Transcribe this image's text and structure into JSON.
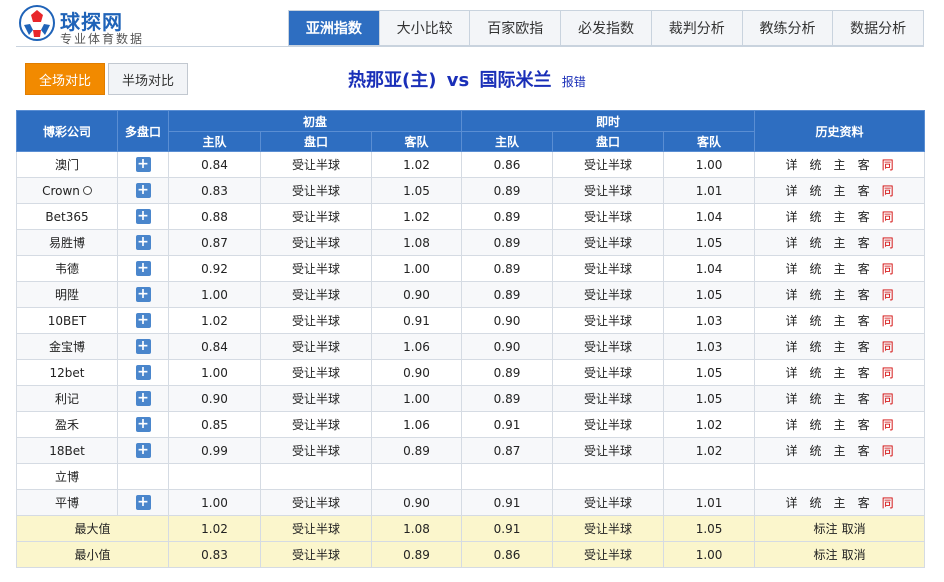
{
  "logo": {
    "title": "球探网",
    "subtitle": "专业体育数据"
  },
  "top_tabs": [
    "亚洲指数",
    "大小比较",
    "百家欧指",
    "必发指数",
    "裁判分析",
    "教练分析",
    "数据分析"
  ],
  "sub_tabs": {
    "full": "全场对比",
    "half": "半场对比"
  },
  "match": {
    "home": "热那亚(主)",
    "vs": "vs",
    "away": "国际米兰",
    "report": "报错"
  },
  "table": {
    "headers": {
      "company": "博彩公司",
      "multi": "多盘口",
      "initial": "初盘",
      "live": "即时",
      "history": "历史资料",
      "home": "主队",
      "handicap": "盘口",
      "away": "客队"
    },
    "history_links": [
      "详",
      "统",
      "主",
      "客",
      "同"
    ],
    "rows": [
      {
        "company": "澳门",
        "plus": true,
        "i_home": "0.84",
        "i_line": "受让半球",
        "i_away": "1.02",
        "l_home": "0.86",
        "l_line": "受让半球",
        "l_away": "1.00",
        "history": true
      },
      {
        "company": "Crown",
        "ball": true,
        "plus": true,
        "i_home": "0.83",
        "i_line": "受让半球",
        "i_away": "1.05",
        "l_home": "0.89",
        "l_line": "受让半球",
        "l_away": "1.01",
        "history": true
      },
      {
        "company": "Bet365",
        "plus": true,
        "i_home": "0.88",
        "i_line": "受让半球",
        "i_away": "1.02",
        "l_home": "0.89",
        "l_line": "受让半球",
        "l_away": "1.04",
        "history": true
      },
      {
        "company": "易胜博",
        "plus": true,
        "i_home": "0.87",
        "i_line": "受让半球",
        "i_away": "1.08",
        "l_home": "0.89",
        "l_line": "受让半球",
        "l_away": "1.05",
        "history": true
      },
      {
        "company": "韦德",
        "plus": true,
        "i_home": "0.92",
        "i_line": "受让半球",
        "i_away": "1.00",
        "l_home": "0.89",
        "l_line": "受让半球",
        "l_away": "1.04",
        "history": true
      },
      {
        "company": "明陞",
        "plus": true,
        "i_home": "1.00",
        "i_line": "受让半球",
        "i_away": "0.90",
        "l_home": "0.89",
        "l_line": "受让半球",
        "l_away": "1.05",
        "history": true
      },
      {
        "company": "10BET",
        "plus": true,
        "i_home": "1.02",
        "i_line": "受让半球",
        "i_away": "0.91",
        "l_home": "0.90",
        "l_line": "受让半球",
        "l_away": "1.03",
        "history": true
      },
      {
        "company": "金宝博",
        "plus": true,
        "i_home": "0.84",
        "i_line": "受让半球",
        "i_away": "1.06",
        "l_home": "0.90",
        "l_line": "受让半球",
        "l_away": "1.03",
        "history": true
      },
      {
        "company": "12bet",
        "plus": true,
        "i_home": "1.00",
        "i_line": "受让半球",
        "i_away": "0.90",
        "l_home": "0.89",
        "l_line": "受让半球",
        "l_away": "1.05",
        "history": true
      },
      {
        "company": "利记",
        "plus": true,
        "i_home": "0.90",
        "i_line": "受让半球",
        "i_away": "1.00",
        "l_home": "0.89",
        "l_line": "受让半球",
        "l_away": "1.05",
        "history": true
      },
      {
        "company": "盈禾",
        "plus": true,
        "i_home": "0.85",
        "i_line": "受让半球",
        "i_away": "1.06",
        "l_home": "0.91",
        "l_line": "受让半球",
        "l_away": "1.02",
        "history": true
      },
      {
        "company": "18Bet",
        "plus": true,
        "i_home": "0.99",
        "i_line": "受让半球",
        "i_away": "0.89",
        "l_home": "0.87",
        "l_line": "受让半球",
        "l_away": "1.02",
        "history": true
      },
      {
        "company": "立博",
        "plus": false,
        "i_home": "",
        "i_line": "",
        "i_away": "",
        "l_home": "",
        "l_line": "",
        "l_away": "",
        "history": false
      },
      {
        "company": "平博",
        "plus": true,
        "i_home": "1.00",
        "i_line": "受让半球",
        "i_away": "0.90",
        "l_home": "0.91",
        "l_line": "受让半球",
        "l_away": "1.01",
        "history": true
      }
    ],
    "summary": [
      {
        "label": "最大值",
        "i_home": "1.02",
        "i_line": "受让半球",
        "i_away": "1.08",
        "l_home": "0.91",
        "l_line": "受让半球",
        "l_away": "1.05",
        "mark": "标注",
        "cancel": "取消"
      },
      {
        "label": "最小值",
        "i_home": "0.83",
        "i_line": "受让半球",
        "i_away": "0.89",
        "l_home": "0.86",
        "l_line": "受让半球",
        "l_away": "1.00",
        "mark": "标注",
        "cancel": "取消"
      }
    ]
  },
  "colors": {
    "header_blue": "#2e6ec1",
    "active_orange": "#f28a00",
    "match_title": "#1a2fb8",
    "summary_bg": "#fbf6cc",
    "history_red": "#d00000"
  }
}
